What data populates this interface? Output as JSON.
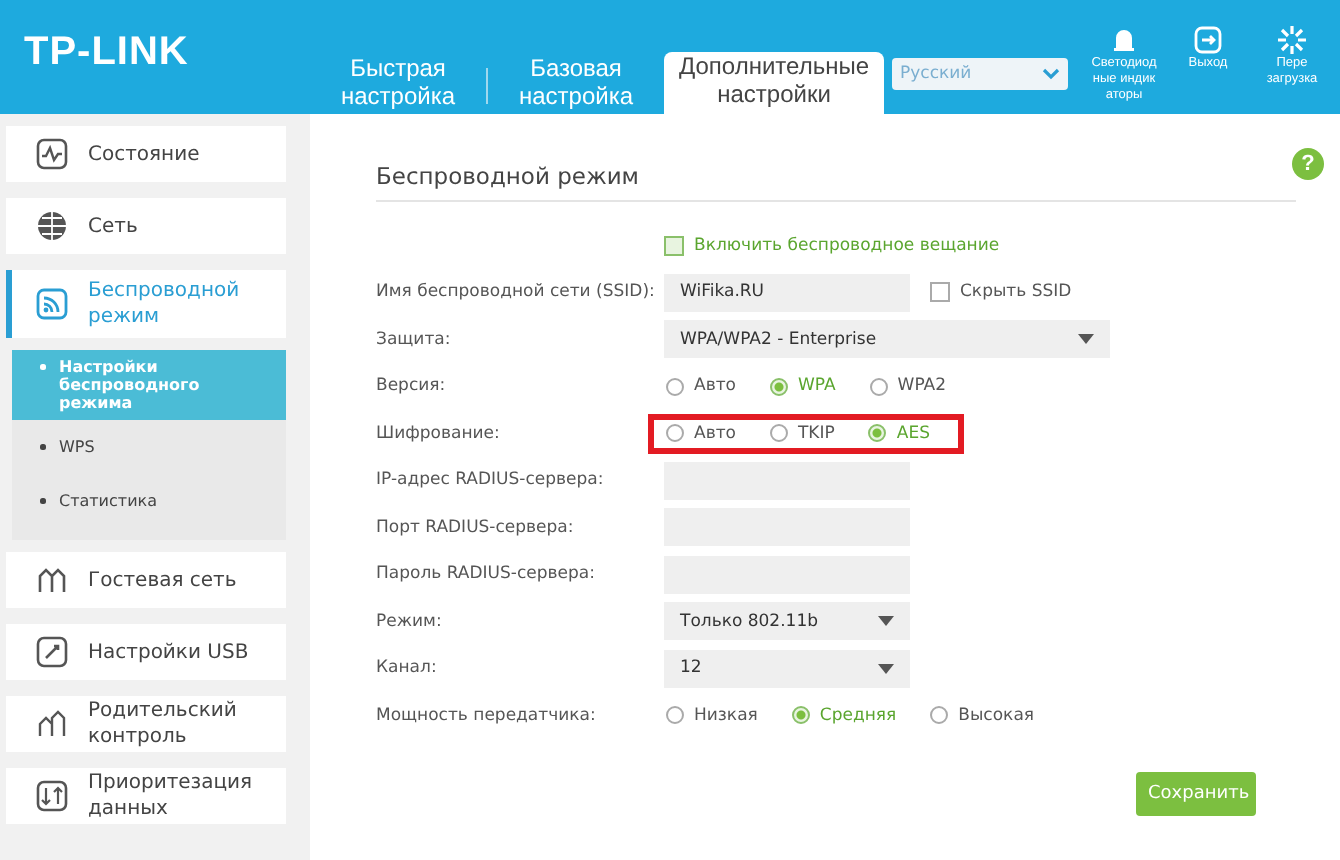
{
  "header": {
    "logo": "TP-LINK",
    "tabs": [
      {
        "label": "Быстрая настройка",
        "selected": false
      },
      {
        "label": "Базовая настройка",
        "selected": false
      },
      {
        "label": "Дополнительные настройки",
        "selected": true
      }
    ],
    "language": "Русский",
    "tools": [
      {
        "kind": "led",
        "lines": [
          "Светодиод",
          "ные индик",
          "аторы"
        ]
      },
      {
        "kind": "logout",
        "lines": [
          "Выход"
        ]
      },
      {
        "kind": "reboot",
        "lines": [
          "Пере",
          "загрузка"
        ]
      }
    ]
  },
  "sidebar": {
    "items": [
      {
        "kind": "status",
        "label": "Состояние",
        "selected": false
      },
      {
        "kind": "network",
        "label": "Сеть",
        "selected": false
      },
      {
        "kind": "wireless",
        "label": "Беспроводной режим",
        "selected": true,
        "children": [
          {
            "label": "Настройки беспроводного режима",
            "selected": true
          },
          {
            "label": "WPS",
            "selected": false
          },
          {
            "label": "Статистика",
            "selected": false
          }
        ]
      },
      {
        "kind": "guest",
        "label": "Гостевая сеть",
        "selected": false
      },
      {
        "kind": "usb",
        "label": "Настройки USB",
        "selected": false
      },
      {
        "kind": "parental",
        "label": "Родительский контроль",
        "selected": false
      },
      {
        "kind": "priority",
        "label": "Приоритезация данных",
        "selected": false
      }
    ]
  },
  "form": {
    "title": "Беспроводной режим",
    "help": "?",
    "rows": [
      {
        "kind": "checkbox",
        "label": "Включить беспроводное вещание",
        "checked": true
      },
      {
        "kind": "text",
        "label": "Имя беспроводной сети (SSID):",
        "value": "WiFika.RU",
        "extra": {
          "label": "Скрыть SSID",
          "checked": false
        }
      },
      {
        "kind": "select",
        "label": "Защита:",
        "value": "WPA/WPA2 - Enterprise",
        "wide": true
      },
      {
        "kind": "radio",
        "label": "Версия:",
        "options": [
          {
            "label": "Авто",
            "selected": false
          },
          {
            "label": "WPA",
            "selected": true
          },
          {
            "label": "WPA2",
            "selected": false
          }
        ]
      },
      {
        "kind": "radio",
        "label": "Шифрование:",
        "highlighted": true,
        "options": [
          {
            "label": "Авто",
            "selected": false
          },
          {
            "label": "TKIP",
            "selected": false
          },
          {
            "label": "AES",
            "selected": true
          }
        ]
      },
      {
        "kind": "text",
        "label": "IP-адрес RADIUS-сервера:"
      },
      {
        "kind": "text",
        "label": "Порт RADIUS-сервера:"
      },
      {
        "kind": "text",
        "label": "Пароль RADIUS-сервера:"
      },
      {
        "kind": "select",
        "label": "Режим:",
        "value": "Только 802.11b",
        "wide": false
      },
      {
        "kind": "select",
        "label": "Канал:",
        "value": "12",
        "wide": false
      },
      {
        "kind": "radio",
        "label": "Мощность передатчика:",
        "options": [
          {
            "label": "Низкая",
            "selected": false
          },
          {
            "label": "Средняя",
            "selected": true
          },
          {
            "label": "Высокая",
            "selected": false
          }
        ]
      }
    ],
    "save": "Сохранить"
  }
}
